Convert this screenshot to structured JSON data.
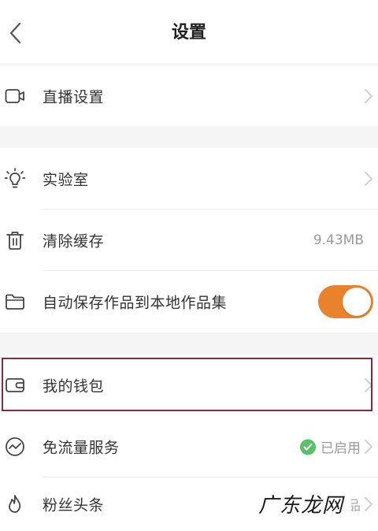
{
  "header": {
    "title": "设置"
  },
  "rows": {
    "live": {
      "label": "直播设置"
    },
    "lab": {
      "label": "实验室"
    },
    "cache": {
      "label": "清除缓存",
      "value": "9.43MB"
    },
    "autosave": {
      "label": "自动保存作品到本地作品集",
      "toggle_on": true
    },
    "wallet": {
      "label": "我的钱包"
    },
    "dataservice": {
      "label": "免流量服务",
      "status": "已启用"
    },
    "fans": {
      "label": "粉丝头条",
      "value": "推广作品"
    }
  },
  "watermark": "广东龙网",
  "colors": {
    "accent": "#e8822c",
    "success": "#5cc06a",
    "highlight_border": "#8a2a36",
    "section_gap": "#f5f5f5"
  }
}
